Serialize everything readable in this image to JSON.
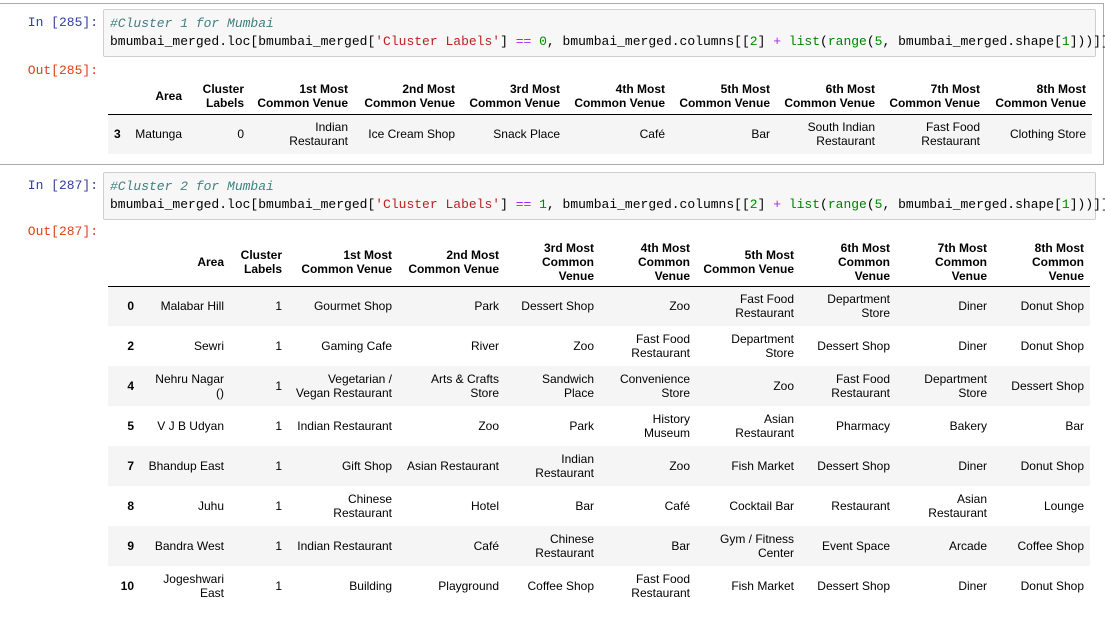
{
  "cells": [
    {
      "in_prompt": "In [285]:",
      "out_prompt": "Out[285]:",
      "comment": "#Cluster 1 for Mumbai",
      "code": {
        "a": "bmumbai_merged.loc[bmumbai_merged[",
        "s": "'Cluster Labels'",
        "b": "] ",
        "eq": "==",
        "sp": " ",
        "n": "0",
        "c": ", bmumbai_merged.columns[[",
        "two": "2",
        "d": "] ",
        "plus": "+",
        "e": " ",
        "list": "list",
        "f": "(",
        "range": "range",
        "g": "(",
        "five": "5",
        "h": ", bmumbai_merged.shape[",
        "one": "1",
        "i": "]))]]"
      },
      "headers": [
        "",
        "Area",
        "Cluster Labels",
        "1st Most Common Venue",
        "2nd Most Common Venue",
        "3rd Most Common Venue",
        "4th Most Common Venue",
        "5th Most Common Venue",
        "6th Most Common Venue",
        "7th Most Common Venue",
        "8th Most Common Venue"
      ],
      "rows": [
        [
          "3",
          "Matunga",
          "0",
          "Indian Restaurant",
          "Ice Cream Shop",
          "Snack Place",
          "Café",
          "Bar",
          "South Indian Restaurant",
          "Fast Food Restaurant",
          "Clothing Store"
        ]
      ]
    },
    {
      "in_prompt": "In [287]:",
      "out_prompt": "Out[287]:",
      "comment": "#Cluster 2 for Mumbai",
      "code": {
        "a": "bmumbai_merged.loc[bmumbai_merged[",
        "s": "'Cluster Labels'",
        "b": "] ",
        "eq": "==",
        "sp": " ",
        "n": "1",
        "c": ", bmumbai_merged.columns[[",
        "two": "2",
        "d": "] ",
        "plus": "+",
        "e": " ",
        "list": "list",
        "f": "(",
        "range": "range",
        "g": "(",
        "five": "5",
        "h": ", bmumbai_merged.shape[",
        "one": "1",
        "i": "]))]]"
      },
      "headers": [
        "",
        "Area",
        "Cluster Labels",
        "1st Most Common Venue",
        "2nd Most Common Venue",
        "3rd Most Common Venue",
        "4th Most Common Venue",
        "5th Most Common Venue",
        "6th Most Common Venue",
        "7th Most Common Venue",
        "8th Most Common Venue"
      ],
      "rows": [
        [
          "0",
          "Malabar Hill",
          "1",
          "Gourmet Shop",
          "Park",
          "Dessert Shop",
          "Zoo",
          "Fast Food Restaurant",
          "Department Store",
          "Diner",
          "Donut Shop"
        ],
        [
          "2",
          "Sewri",
          "1",
          "Gaming Cafe",
          "River",
          "Zoo",
          "Fast Food Restaurant",
          "Department Store",
          "Dessert Shop",
          "Diner",
          "Donut Shop"
        ],
        [
          "4",
          "Nehru Nagar ()",
          "1",
          "Vegetarian / Vegan Restaurant",
          "Arts & Crafts Store",
          "Sandwich Place",
          "Convenience Store",
          "Zoo",
          "Fast Food Restaurant",
          "Department Store",
          "Dessert Shop"
        ],
        [
          "5",
          "V J B Udyan",
          "1",
          "Indian Restaurant",
          "Zoo",
          "Park",
          "History Museum",
          "Asian Restaurant",
          "Pharmacy",
          "Bakery",
          "Bar"
        ],
        [
          "7",
          "Bhandup East",
          "1",
          "Gift Shop",
          "Asian Restaurant",
          "Indian Restaurant",
          "Zoo",
          "Fish Market",
          "Dessert Shop",
          "Diner",
          "Donut Shop"
        ],
        [
          "8",
          "Juhu",
          "1",
          "Chinese Restaurant",
          "Hotel",
          "Bar",
          "Café",
          "Cocktail Bar",
          "Restaurant",
          "Asian Restaurant",
          "Lounge"
        ],
        [
          "9",
          "Bandra West",
          "1",
          "Indian Restaurant",
          "Café",
          "Chinese Restaurant",
          "Bar",
          "Gym / Fitness Center",
          "Event Space",
          "Arcade",
          "Coffee Shop"
        ],
        [
          "10",
          "Jogeshwari East",
          "1",
          "Building",
          "Playground",
          "Coffee Shop",
          "Fast Food Restaurant",
          "Fish Market",
          "Dessert Shop",
          "Diner",
          "Donut Shop"
        ]
      ]
    }
  ]
}
